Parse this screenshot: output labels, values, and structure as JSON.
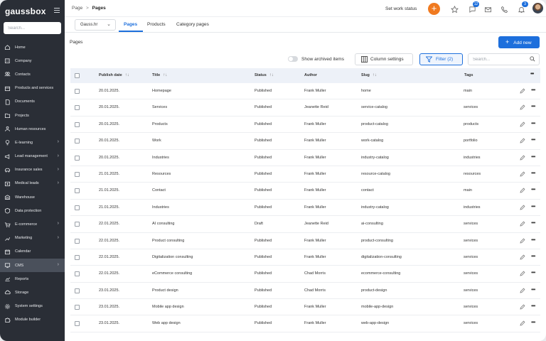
{
  "brand": {
    "logo_text": "gaussbox"
  },
  "sidebar": {
    "search_placeholder": "Search...",
    "items": [
      {
        "label": "Home",
        "icon": "home-icon",
        "chevron": false,
        "active": false
      },
      {
        "label": "Company",
        "icon": "building-icon",
        "chevron": false,
        "active": false
      },
      {
        "label": "Contacts",
        "icon": "contacts-icon",
        "chevron": false,
        "active": false
      },
      {
        "label": "Products and services",
        "icon": "box-icon",
        "chevron": false,
        "active": false
      },
      {
        "label": "Documents",
        "icon": "document-icon",
        "chevron": false,
        "active": false
      },
      {
        "label": "Projects",
        "icon": "folder-icon",
        "chevron": false,
        "active": false
      },
      {
        "label": "Human resources",
        "icon": "people-icon",
        "chevron": false,
        "active": false
      },
      {
        "label": "E-learning",
        "icon": "bulb-icon",
        "chevron": true,
        "active": false
      },
      {
        "label": "Lead management",
        "icon": "megaphone-icon",
        "chevron": true,
        "active": false
      },
      {
        "label": "Insurance sales",
        "icon": "car-icon",
        "chevron": true,
        "active": false
      },
      {
        "label": "Medical leads",
        "icon": "medical-icon",
        "chevron": true,
        "active": false
      },
      {
        "label": "Warehouse",
        "icon": "warehouse-icon",
        "chevron": false,
        "active": false
      },
      {
        "label": "Data protection",
        "icon": "shield-icon",
        "chevron": false,
        "active": false
      },
      {
        "label": "E-commerce",
        "icon": "cart-icon",
        "chevron": true,
        "active": false
      },
      {
        "label": "Marketing",
        "icon": "marketing-icon",
        "chevron": true,
        "active": false
      },
      {
        "label": "Calendar",
        "icon": "calendar-icon",
        "chevron": false,
        "active": false
      },
      {
        "label": "CMS",
        "icon": "cms-icon",
        "chevron": true,
        "active": true
      },
      {
        "label": "Reports",
        "icon": "chart-icon",
        "chevron": false,
        "active": false
      },
      {
        "label": "Storage",
        "icon": "cloud-icon",
        "chevron": false,
        "active": false
      },
      {
        "label": "System settings",
        "icon": "gear-icon",
        "chevron": false,
        "active": false
      },
      {
        "label": "Module builder",
        "icon": "puzzle-icon",
        "chevron": false,
        "active": false
      }
    ]
  },
  "topbar": {
    "breadcrumb_root": "Page",
    "breadcrumb_separator": ">",
    "breadcrumb_current": "Pages",
    "work_status": "Set work status",
    "plus_label": "+",
    "messages_badge": "12",
    "notifications_badge": "3"
  },
  "subbar": {
    "domain": "Gauss.hr",
    "tabs": [
      "Pages",
      "Products",
      "Category pages"
    ],
    "active_tab": "Pages"
  },
  "toolbar": {
    "page_title": "Pages",
    "add_new": "Add new",
    "show_archived": "Show archived items",
    "column_settings": "Column settings",
    "filter": "Filter (2)",
    "search_placeholder": "Search..."
  },
  "table": {
    "headers": {
      "publish_date": "Publish date",
      "title": "Title",
      "status": "Status",
      "author": "Author",
      "slug": "Slug",
      "tags": "Tags",
      "more": "•••"
    },
    "rows": [
      {
        "date": "20.01.2025.",
        "title": "Homepage",
        "status": "Published",
        "author": "Frank Muller",
        "slug": "home",
        "tags": "main"
      },
      {
        "date": "20.01.2025.",
        "title": "Services",
        "status": "Published",
        "author": "Jeanette Reid",
        "slug": "service-catalog",
        "tags": "services"
      },
      {
        "date": "20.01.2025.",
        "title": "Products",
        "status": "Published",
        "author": "Frank Muller",
        "slug": "product-catalog",
        "tags": "products"
      },
      {
        "date": "20.01.2025.",
        "title": "Work",
        "status": "Published",
        "author": "Frank Muller",
        "slug": "work-catalog",
        "tags": "portfolio"
      },
      {
        "date": "20.01.2025.",
        "title": "Industries",
        "status": "Published",
        "author": "Frank Muller",
        "slug": "industry-catalog",
        "tags": "industries"
      },
      {
        "date": "21.01.2025.",
        "title": "Resources",
        "status": "Published",
        "author": "Frank Muller",
        "slug": "resource-catalog",
        "tags": "resources"
      },
      {
        "date": "21.01.2025.",
        "title": "Contact",
        "status": "Published",
        "author": "Frank Muller",
        "slug": "contact",
        "tags": "main"
      },
      {
        "date": "21.01.2025.",
        "title": "Industries",
        "status": "Published",
        "author": "Frank Muller",
        "slug": "industry-catalog",
        "tags": "industries"
      },
      {
        "date": "22.01.2025.",
        "title": "AI consulting",
        "status": "Draft",
        "author": "Jeanette Reid",
        "slug": "ai-consulting",
        "tags": "services"
      },
      {
        "date": "22.01.2025.",
        "title": "Product consulting",
        "status": "Published",
        "author": "Frank Muller",
        "slug": "product-consulting",
        "tags": "services"
      },
      {
        "date": "22.01.2025.",
        "title": "Digitalization consulting",
        "status": "Published",
        "author": "Frank Muller",
        "slug": "digitalization-consulting",
        "tags": "services"
      },
      {
        "date": "22.01.2025.",
        "title": "eCommerce consulting",
        "status": "Published",
        "author": "Chad Morris",
        "slug": "ecommerce-consulting",
        "tags": "services"
      },
      {
        "date": "23.01.2025.",
        "title": "Product design",
        "status": "Published",
        "author": "Chad Morris",
        "slug": "product-design",
        "tags": "services"
      },
      {
        "date": "23.01.2025.",
        "title": "Mobile app design",
        "status": "Published",
        "author": "Frank Muller",
        "slug": "mobile-app-design",
        "tags": "services"
      },
      {
        "date": "23.01.2025.",
        "title": "Web app design",
        "status": "Published",
        "author": "Frank Muller",
        "slug": "web-app-design",
        "tags": "services"
      }
    ]
  },
  "colors": {
    "sidebar_bg": "#2a2e36",
    "accent": "#1d6fdc",
    "fab": "#f07a20",
    "header_bg": "#edf1f8"
  }
}
